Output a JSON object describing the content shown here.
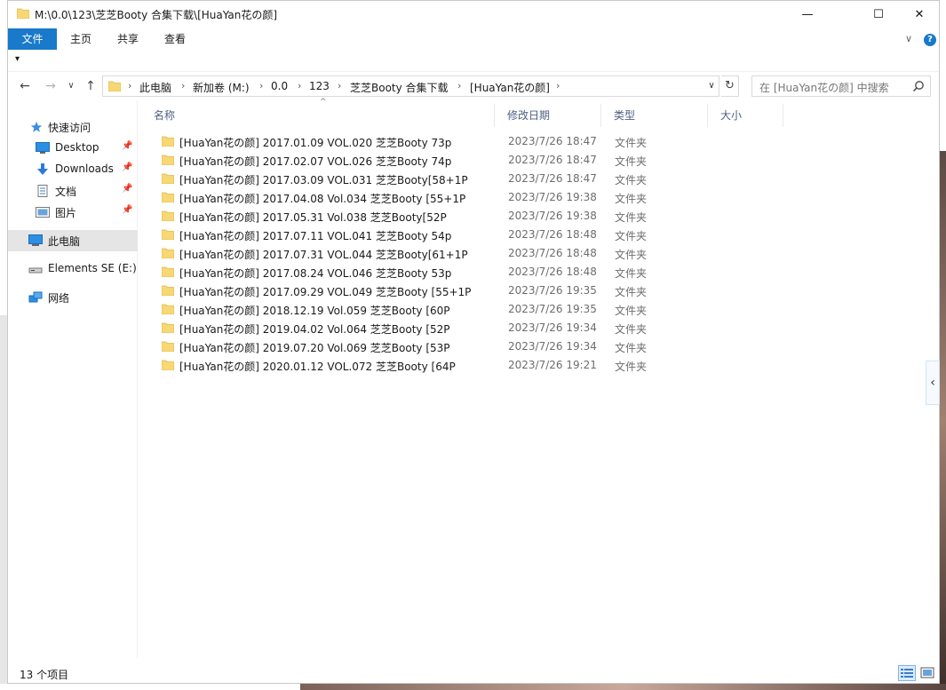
{
  "window": {
    "title": "M:\\0.0\\123\\芝芝Booty 合集下载\\[HuaYan花の颜]",
    "minimize": "—",
    "maximize": "☐",
    "close": "✕"
  },
  "ribbon": {
    "tabs": [
      "文件",
      "主页",
      "共享",
      "查看"
    ],
    "expand": "∨",
    "help": "?"
  },
  "quick_access_toggle": "▾",
  "nav": {
    "back": "←",
    "forward": "→",
    "recent": "∨",
    "up": "↑",
    "breadcrumbs": [
      "此电脑",
      "新加卷 (M:)",
      "0.0",
      "123",
      "芝芝Booty 合集下载",
      "[HuaYan花の颜]"
    ],
    "separator": "›",
    "dropdown": "∨",
    "refresh": "↻",
    "search_placeholder": "在 [HuaYan花の颜] 中搜索"
  },
  "sidebar": {
    "items": [
      {
        "label": "快速访问",
        "icon": "star-icon",
        "pinned": false
      },
      {
        "label": "Desktop",
        "icon": "desktop-icon",
        "pinned": true
      },
      {
        "label": "Downloads",
        "icon": "download-icon",
        "pinned": true
      },
      {
        "label": "文档",
        "icon": "document-icon",
        "pinned": true
      },
      {
        "label": "图片",
        "icon": "picture-icon",
        "pinned": true
      },
      {
        "label": "此电脑",
        "icon": "computer-icon",
        "pinned": false,
        "selected": true
      },
      {
        "label": "Elements SE (E:)",
        "icon": "drive-icon",
        "pinned": false
      },
      {
        "label": "网络",
        "icon": "network-icon",
        "pinned": false
      }
    ],
    "pin_glyph": "📌"
  },
  "columns": {
    "name": "名称",
    "date": "修改日期",
    "type": "类型",
    "size": "大小",
    "sort_indicator": "^"
  },
  "files": [
    {
      "name": "[HuaYan花の颜] 2017.01.09 VOL.020 芝芝Booty 73p",
      "date": "2023/7/26 18:47",
      "type": "文件夹"
    },
    {
      "name": "[HuaYan花の颜] 2017.02.07 VOL.026 芝芝Booty 74p",
      "date": "2023/7/26 18:47",
      "type": "文件夹"
    },
    {
      "name": "[HuaYan花の颜] 2017.03.09 VOL.031 芝芝Booty[58+1P",
      "date": "2023/7/26 18:47",
      "type": "文件夹"
    },
    {
      "name": "[HuaYan花の颜] 2017.04.08 Vol.034 芝芝Booty [55+1P",
      "date": "2023/7/26 19:38",
      "type": "文件夹"
    },
    {
      "name": "[HuaYan花の颜] 2017.05.31 Vol.038 芝芝Booty[52P",
      "date": "2023/7/26 19:38",
      "type": "文件夹"
    },
    {
      "name": "[HuaYan花の颜] 2017.07.11 VOL.041 芝芝Booty 54p",
      "date": "2023/7/26 18:48",
      "type": "文件夹"
    },
    {
      "name": "[HuaYan花の颜] 2017.07.31 VOL.044 芝芝Booty[61+1P",
      "date": "2023/7/26 18:48",
      "type": "文件夹"
    },
    {
      "name": "[HuaYan花の颜] 2017.08.24 VOL.046 芝芝Booty 53p",
      "date": "2023/7/26 18:48",
      "type": "文件夹"
    },
    {
      "name": "[HuaYan花の颜] 2017.09.29 VOL.049 芝芝Booty [55+1P",
      "date": "2023/7/26 19:35",
      "type": "文件夹"
    },
    {
      "name": "[HuaYan花の颜] 2018.12.19 Vol.059 芝芝Booty [60P",
      "date": "2023/7/26 19:35",
      "type": "文件夹"
    },
    {
      "name": "[HuaYan花の颜] 2019.04.02 Vol.064 芝芝Booty [52P",
      "date": "2023/7/26 19:34",
      "type": "文件夹"
    },
    {
      "name": "[HuaYan花の颜] 2019.07.20 Vol.069 芝芝Booty [53P",
      "date": "2023/7/26 19:34",
      "type": "文件夹"
    },
    {
      "name": "[HuaYan花の颜] 2020.01.12 VOL.072 芝芝Booty [64P",
      "date": "2023/7/26 19:21",
      "type": "文件夹"
    }
  ],
  "details_toggle": "‹",
  "status": {
    "item_count": "13 个项目"
  },
  "colors": {
    "accent": "#1979ca",
    "folder": "#f8d775",
    "folder_dark": "#e0b848",
    "header_text": "#4d6082",
    "selected": "#e5e5e5"
  }
}
